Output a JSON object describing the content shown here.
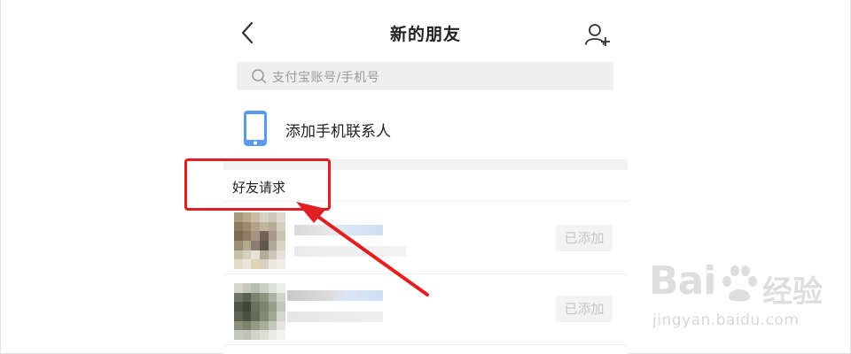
{
  "nav": {
    "title": "新的朋友",
    "back_icon": "chevron-left-icon",
    "add_icon": "add-user-icon"
  },
  "search": {
    "placeholder": "支付宝账号/手机号"
  },
  "contacts": {
    "label": "添加手机联系人",
    "icon": "mobile-phone-icon",
    "icon_color": "#5b9bec"
  },
  "friend_requests": {
    "title": "好友请求",
    "items": [
      {
        "status": "已添加"
      },
      {
        "status": "已添加"
      }
    ]
  },
  "annotation": {
    "color": "#e02020"
  },
  "watermark": {
    "logo_text": "Bai",
    "logo_suffix": "经验",
    "url": "jingyan.baidu.com"
  }
}
